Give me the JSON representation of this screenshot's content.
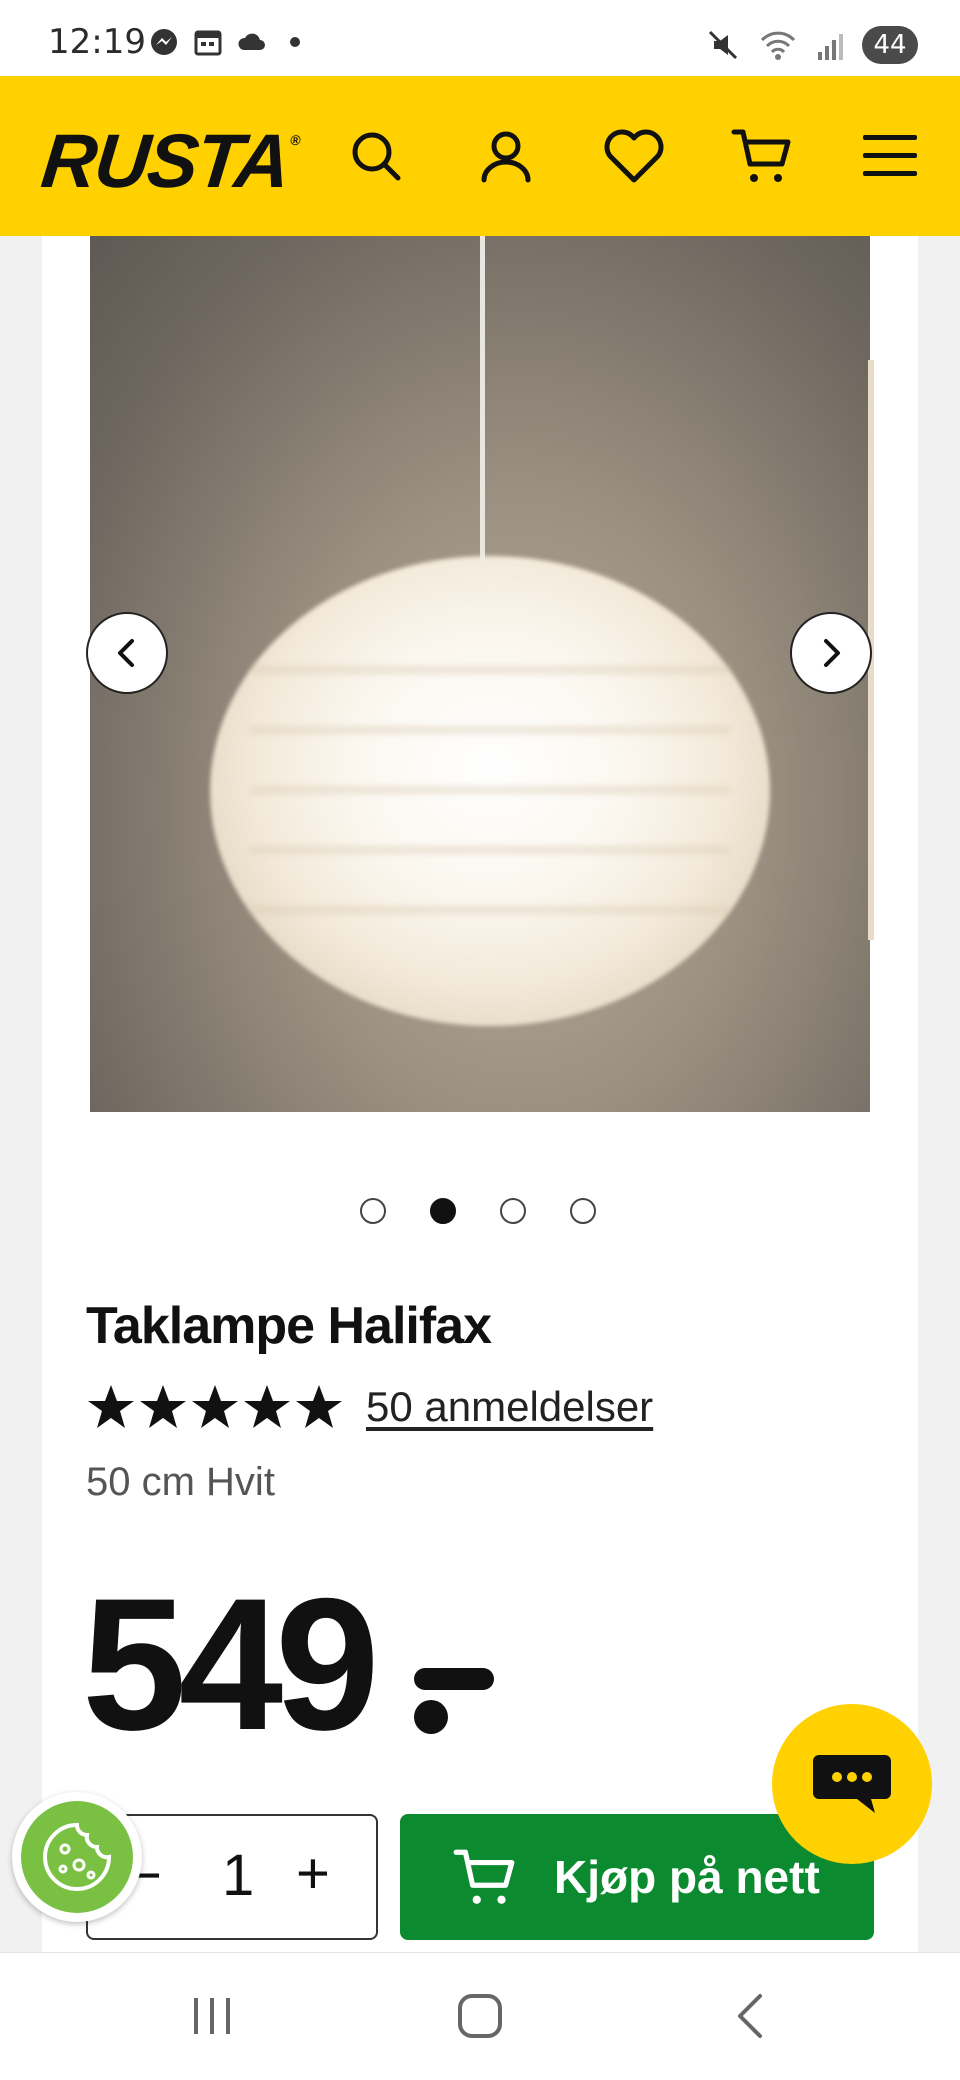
{
  "status_bar": {
    "time": "12:19",
    "icons_left": [
      "messenger-icon",
      "calendar-icon",
      "cloud-icon"
    ],
    "icons_right": [
      "mute-icon",
      "wifi-icon",
      "signal-icon"
    ],
    "battery": "44"
  },
  "header": {
    "logo": "RUSTA",
    "logo_mark": "®",
    "icons": [
      "search-icon",
      "account-icon",
      "wishlist-heart-icon",
      "cart-icon",
      "menu-icon"
    ],
    "background": "#ffd100"
  },
  "gallery": {
    "image_alt": "Taklampe Halifax",
    "total_slides": 4,
    "active_slide": 2
  },
  "product": {
    "title": "Taklampe Halifax",
    "rating": 5,
    "reviews": "50 anmeldelser",
    "variant": "50 cm Hvit",
    "price": "549"
  },
  "purchase": {
    "qty_minus": "−",
    "qty_value": "1",
    "qty_plus": "+",
    "buy_label": "Kjøp på nett",
    "buy_color": "#0b8a2f"
  },
  "floating": {
    "chat": "chat-icon",
    "cookie": "cookie-icon"
  },
  "bottom_nav": [
    "recent-apps-icon",
    "home-icon",
    "back-icon"
  ]
}
